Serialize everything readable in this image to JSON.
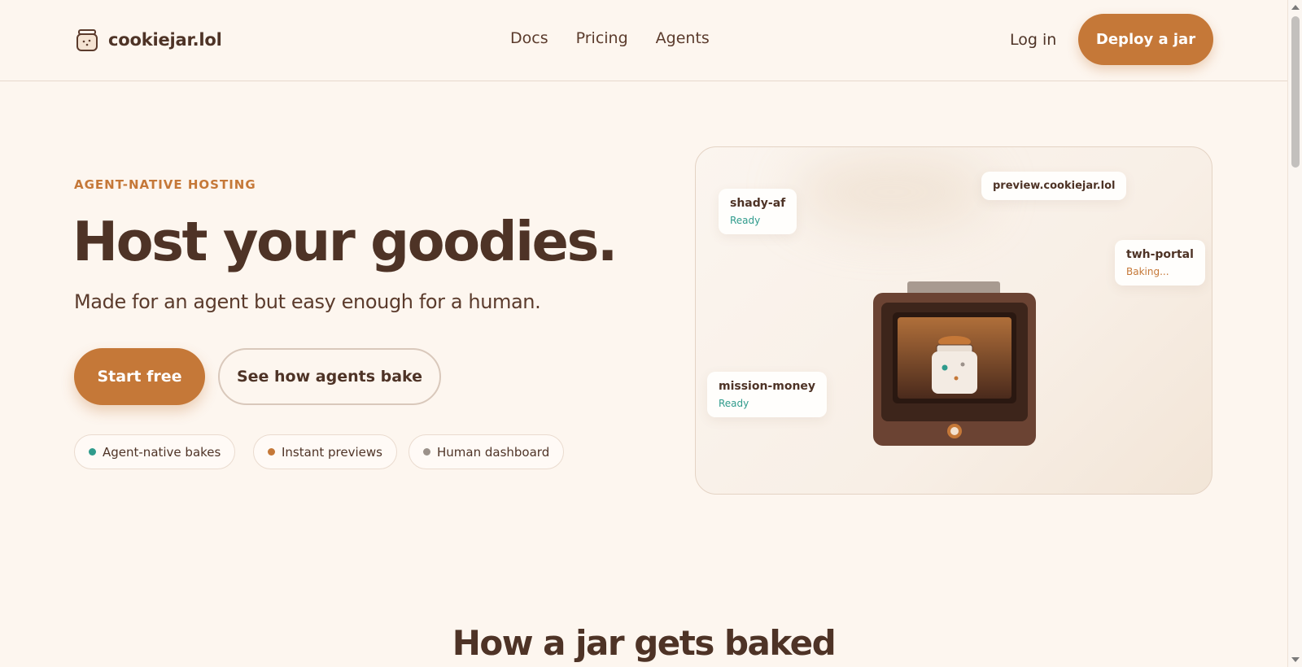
{
  "header": {
    "brand": "cookiejar.lol",
    "nav": [
      {
        "label": "Docs"
      },
      {
        "label": "Pricing"
      },
      {
        "label": "Agents"
      }
    ],
    "login_label": "Log in",
    "deploy_label": "Deploy a jar"
  },
  "hero": {
    "eyebrow": "AGENT-NATIVE HOSTING",
    "title": "Host your goodies.",
    "subtitle": "Made for an agent but easy enough for a human.",
    "primary_cta": "Start free",
    "secondary_cta": "See how agents bake",
    "pills": [
      {
        "label": "Agent-native bakes",
        "dot_color": "#2f9b8c"
      },
      {
        "label": "Instant previews",
        "dot_color": "#c57838"
      },
      {
        "label": "Human dashboard",
        "dot_color": "#9b918a"
      }
    ]
  },
  "illustration": {
    "tags": [
      {
        "name": "shady-af",
        "status": "Ready"
      },
      {
        "name": "preview.cookiejar.lol"
      },
      {
        "name": "twh-portal",
        "status": "Baking..."
      },
      {
        "name": "mission-money",
        "status": "Ready"
      }
    ]
  },
  "section": {
    "title": "How a jar gets baked"
  },
  "colors": {
    "accent": "#c57838",
    "text": "#4e3326",
    "ready": "#2f9b8c",
    "background": "#fdf6ef"
  }
}
